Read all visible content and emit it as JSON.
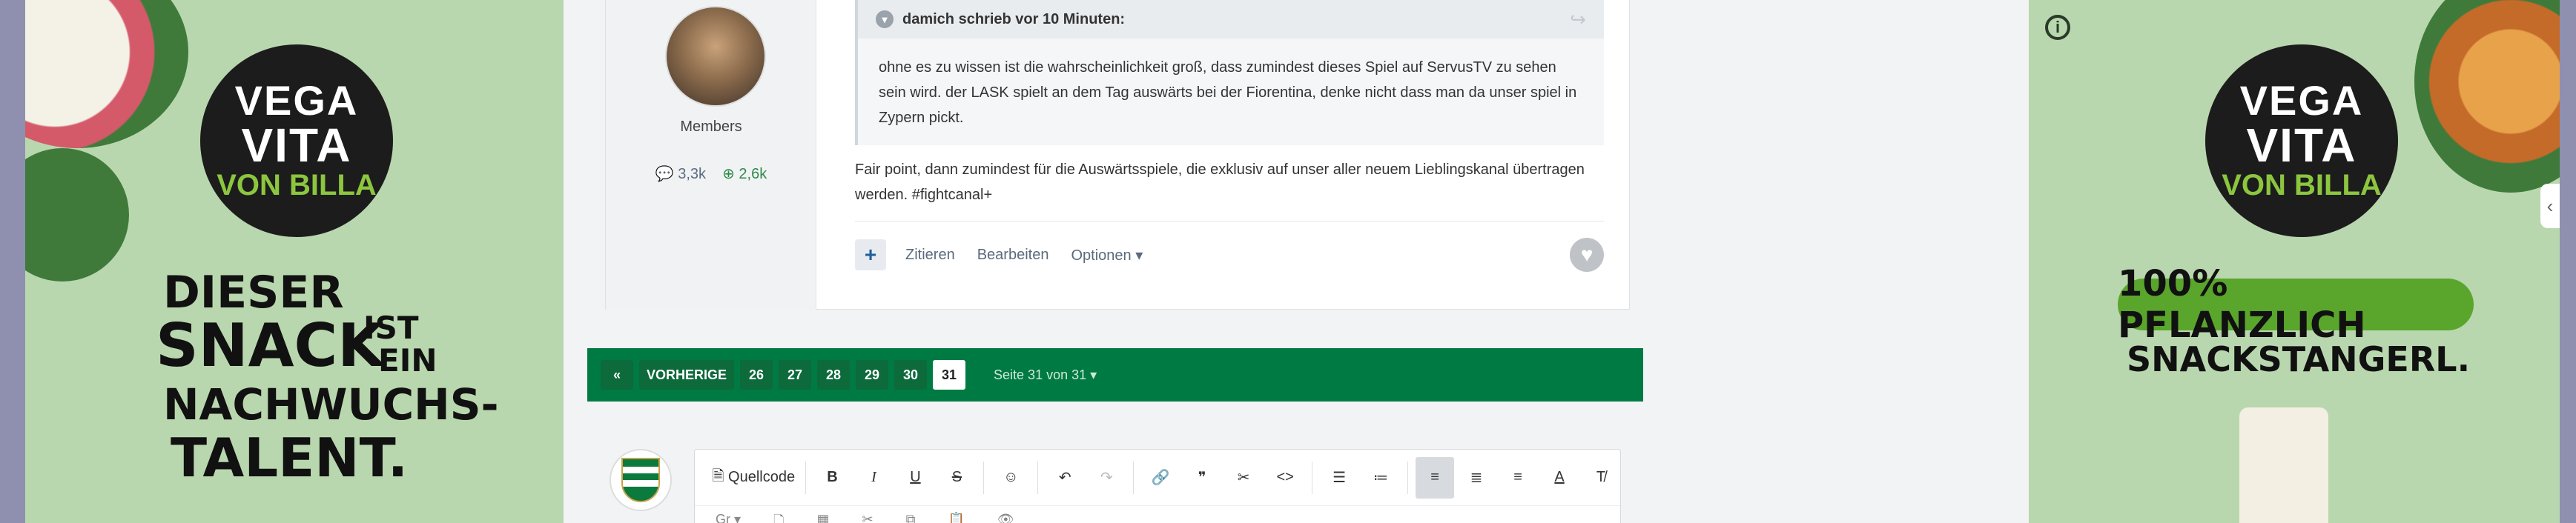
{
  "left_ad": {
    "brand_line1": "VEGA",
    "brand_line2": "VITA",
    "brand_line3": "VON BILLA",
    "slogan_line1": "DIESER",
    "slogan_line2": "SNACK",
    "slogan_line2b": "IST",
    "slogan_line2c": "EIN",
    "slogan_line3": "NACHWUCHS-",
    "slogan_line4": "TALENT."
  },
  "right_ad": {
    "brand_line1": "VEGA",
    "brand_line2": "VITA",
    "brand_line3": "VON BILLA",
    "claim": "100% PFLANZLICH",
    "product": "SNACKSTANGERL."
  },
  "post": {
    "member_group": "Members",
    "post_count": "3,3k",
    "reputation": "2,6k",
    "quote_header": "damich schrieb vor 10 Minuten:",
    "quote_text": "ohne es zu wissen ist die wahrscheinlichkeit groß, dass zumindest dieses Spiel auf ServusTV zu sehen sein wird. der LASK spielt an dem Tag auswärts bei der Fiorentina, denke nicht dass man da unser spiel in Zypern pickt.",
    "body": "Fair point, dann zumindest für die Auswärtsspiele, die exklusiv auf unser aller neuem Lieblingskanal übertragen werden. #fightcanal+",
    "actions": {
      "plus": "+",
      "quote": "Zitieren",
      "edit": "Bearbeiten",
      "options": "Optionen"
    }
  },
  "pagination": {
    "first": "«",
    "prev": "VORHERIGE",
    "pages": [
      "26",
      "27",
      "28",
      "29",
      "30",
      "31"
    ],
    "current": "31",
    "info": "Seite 31 von 31"
  },
  "editor": {
    "source": "Quellcode",
    "bold": "B",
    "italic": "I",
    "underline": "U",
    "strike": "S",
    "format_select": "Gr"
  },
  "colors": {
    "pager_green": "#007a43",
    "ad_green": "#b9d7ae",
    "rep_green": "#2d8a4a"
  }
}
